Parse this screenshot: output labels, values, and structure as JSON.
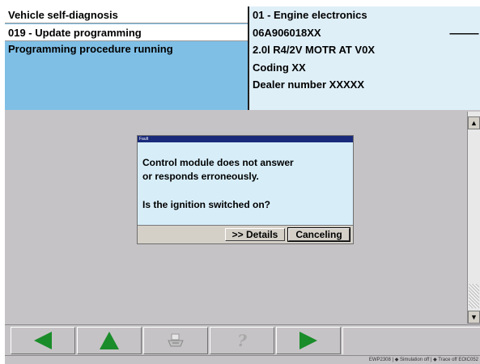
{
  "header": {
    "title": "Vehicle self-diagnosis",
    "function": "019 - Update programming",
    "status": "Programming procedure running",
    "ecu": "01 - Engine electronics",
    "part_number": "06A906018XX",
    "part_dashes": "------------",
    "engine": "2.0l R4/2V  MOTR AT V0X",
    "coding": "Coding  XX",
    "dealer": "Dealer number  XXXXX"
  },
  "dialog": {
    "title": "Fault",
    "message_line1": "Control module does not answer",
    "message_line2": "or responds erroneously.",
    "question": "Is the ignition switched on?",
    "details_label": ">> Details",
    "cancel_label": "Canceling"
  },
  "scrollbar": {
    "up_glyph": "▲",
    "down_glyph": "▼"
  },
  "toolbar": {
    "icons": [
      "back-arrow-icon",
      "up-arrow-icon",
      "printer-icon",
      "help-icon",
      "forward-arrow-icon"
    ],
    "help_glyph": "?",
    "accent_green": "#1a8c2a"
  },
  "statusbar": {
    "text": "EWP2308 | ◆ Simulation off | ◆ Trace off   EOIC052"
  }
}
